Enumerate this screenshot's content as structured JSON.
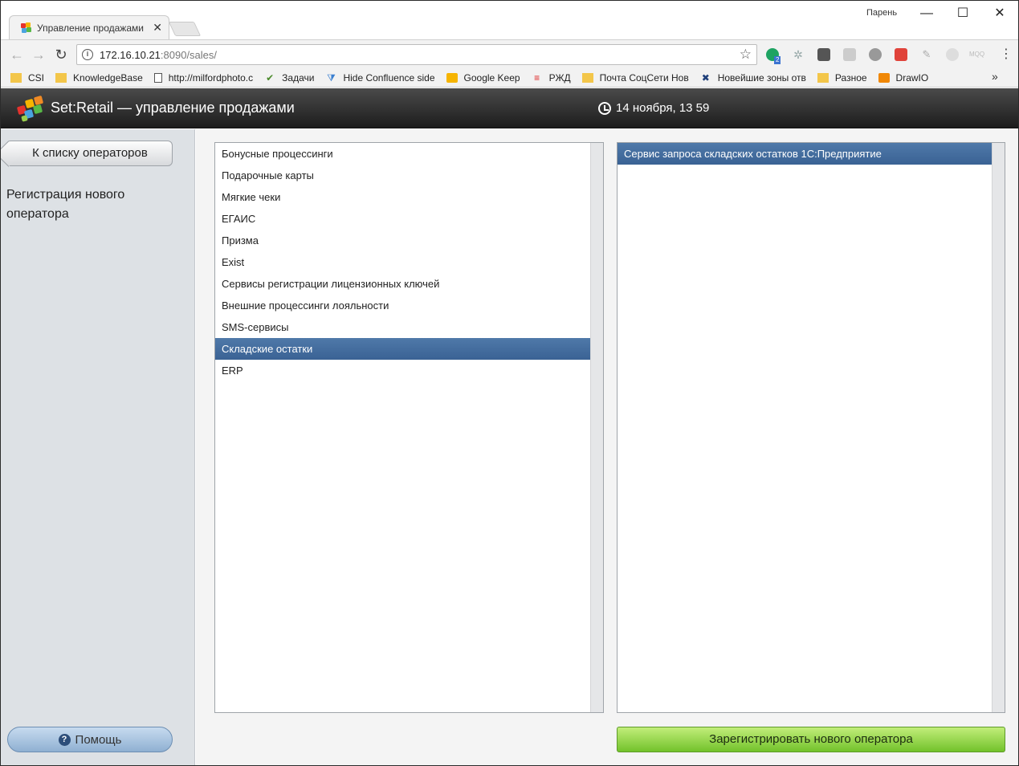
{
  "browser": {
    "tab_title": "Управление продажами",
    "tab_close": "✕",
    "profile_name": "Парень",
    "url_host": "172.16.10.21",
    "url_rest": ":8090/sales/",
    "bookmarks": [
      {
        "label": "CSI",
        "icon": "folder-icon"
      },
      {
        "label": "KnowledgeBase",
        "icon": "folder-icon"
      },
      {
        "label": "http://milfordphoto.c",
        "icon": "page-icon"
      },
      {
        "label": "Задачи",
        "icon": "check-icon"
      },
      {
        "label": "Hide Confluence side",
        "icon": "filter-icon"
      },
      {
        "label": "Google Keep",
        "icon": "keep-icon"
      },
      {
        "label": "РЖД",
        "icon": "rzd-icon"
      },
      {
        "label": "Почта СоцСети Нов",
        "icon": "folder-icon"
      },
      {
        "label": "Новейшие зоны отв",
        "icon": "x-icon"
      },
      {
        "label": "Разное",
        "icon": "folder-icon"
      },
      {
        "label": "DrawIO",
        "icon": "drawio-icon"
      }
    ],
    "bookmarks_more": "»",
    "ext_badge": "2",
    "ext_mqq": "MQQ"
  },
  "app": {
    "title": "Set:Retail — управление продажами",
    "datetime": "14 ноября, 13 59"
  },
  "sidebar": {
    "back_label": "К списку операторов",
    "heading": "Регистрация нового оператора",
    "help_label": "Помощь",
    "help_icon": "?"
  },
  "categories": [
    "Бонусные процессинги",
    "Подарочные карты",
    "Мягкие чеки",
    "ЕГАИС",
    "Призма",
    "Exist",
    "Сервисы регистрации лицензионных ключей",
    "Внешние процессинги лояльности",
    "SMS-сервисы",
    "Складские остатки",
    "ERP"
  ],
  "selected_category_index": 9,
  "services": [
    "Сервис запроса складских остатков 1С:Предприятие"
  ],
  "register_label": "Зарегистрировать нового оператора",
  "colors": {
    "selected": "#3f6898",
    "register": "#8cd43f",
    "help": "#a9c5e3"
  }
}
